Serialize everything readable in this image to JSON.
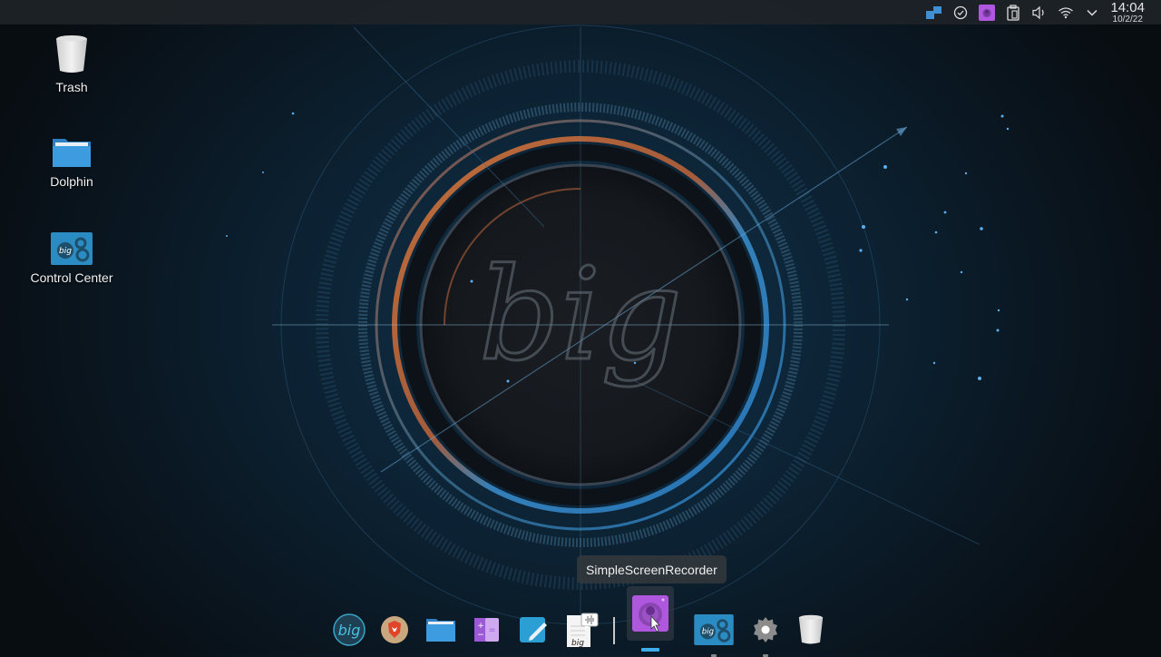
{
  "top_panel": {
    "tray": [
      {
        "name": "virtual-desktop-icon",
        "label": "Virtual Desktops"
      },
      {
        "name": "check-circle-icon",
        "label": "Updates"
      },
      {
        "name": "screen-recorder-tray-icon",
        "label": "SimpleScreenRecorder"
      },
      {
        "name": "clipboard-icon",
        "label": "Clipboard"
      },
      {
        "name": "volume-icon",
        "label": "Volume"
      },
      {
        "name": "wifi-icon",
        "label": "Network"
      },
      {
        "name": "chevron-down-icon",
        "label": "Show hidden icons"
      }
    ],
    "clock": {
      "time": "14:04",
      "date": "10/2/22"
    }
  },
  "desktop": {
    "icons": [
      {
        "label": "Trash",
        "icon": "trash-icon"
      },
      {
        "label": "Dolphin",
        "icon": "folder-icon"
      },
      {
        "label": "Control Center",
        "icon": "control-center-icon"
      }
    ]
  },
  "dock": {
    "items": [
      {
        "name": "biglinux-menu",
        "icon": "biglinux-logo-icon",
        "running": false
      },
      {
        "name": "brave-browser",
        "icon": "brave-icon",
        "running": false
      },
      {
        "name": "dolphin",
        "icon": "folder-icon",
        "running": false
      },
      {
        "name": "calculator",
        "icon": "calculator-icon",
        "running": false
      },
      {
        "name": "text-editor",
        "icon": "pencil-icon",
        "running": false
      },
      {
        "name": "voice-typing",
        "icon": "document-voice-icon",
        "running": false
      },
      {
        "name": "simplescreenrecorder",
        "icon": "screen-recorder-icon",
        "running": true,
        "active": true
      },
      {
        "name": "control-center",
        "icon": "control-center-icon",
        "running": true
      },
      {
        "name": "settings",
        "icon": "gear-icon",
        "running": true
      },
      {
        "name": "trash",
        "icon": "trash-icon",
        "running": false
      }
    ],
    "tooltip": "SimpleScreenRecorder"
  },
  "colors": {
    "accent": "#3daee9",
    "recorder_purple": "#b057e0",
    "panel_bg": "#1e2328"
  }
}
